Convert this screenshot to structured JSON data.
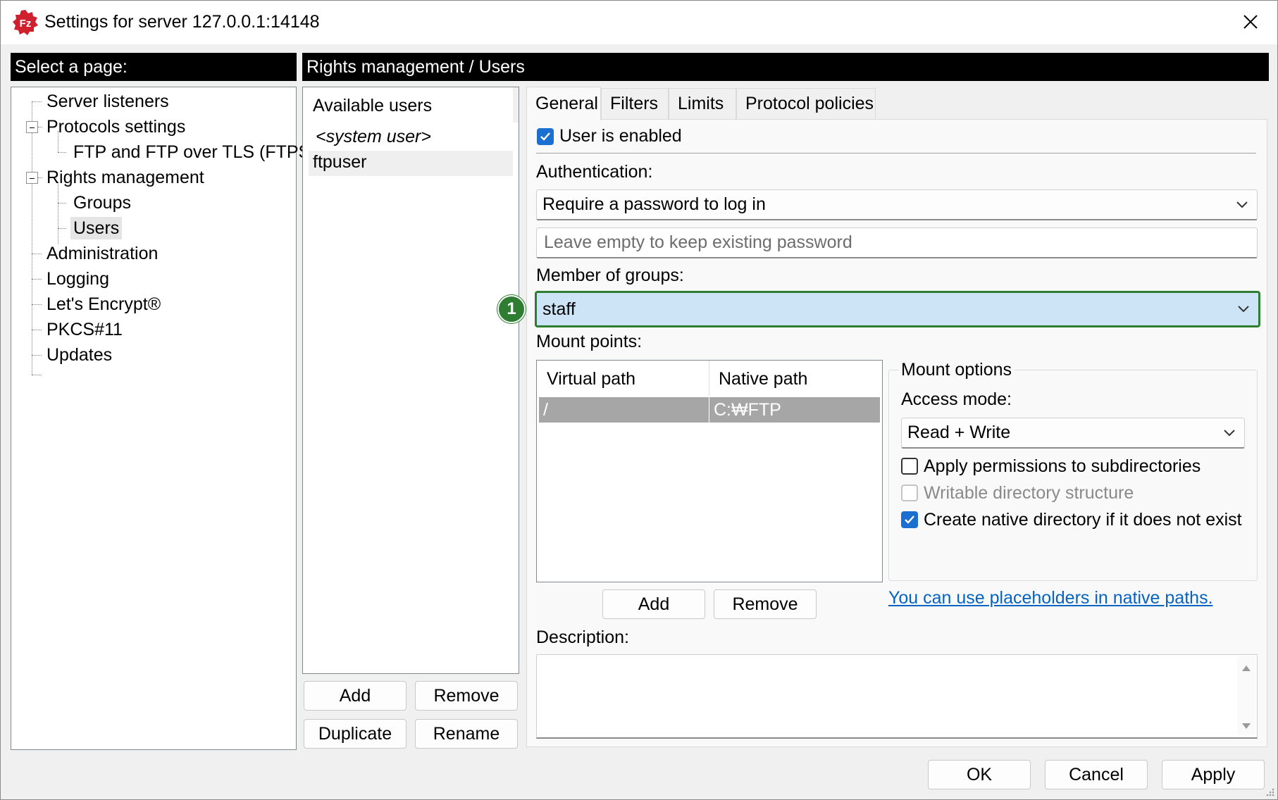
{
  "window": {
    "title": "Settings for server 127.0.0.1:14148"
  },
  "left_header": "Select a page:",
  "right_header": "Rights management / Users",
  "tree": {
    "server_listeners": "Server listeners",
    "protocols_settings": "Protocols settings",
    "ftp_ftps": "FTP and FTP over TLS (FTPS)",
    "rights_management": "Rights management",
    "groups": "Groups",
    "users": "Users",
    "administration": "Administration",
    "logging": "Logging",
    "lets_encrypt": "Let's Encrypt®",
    "pkcs11": "PKCS#11",
    "updates": "Updates"
  },
  "users_panel": {
    "header": "Available users",
    "items": [
      "<system user>",
      "ftpuser"
    ],
    "selected": "ftpuser",
    "add": "Add",
    "remove": "Remove",
    "duplicate": "Duplicate",
    "rename": "Rename"
  },
  "tabs": [
    "General",
    "Filters",
    "Limits",
    "Protocol policies"
  ],
  "active_tab": "General",
  "general": {
    "user_enabled_label": "User is enabled",
    "user_enabled": true,
    "authentication_label": "Authentication:",
    "authentication_value": "Require a password to log in",
    "password_placeholder": "Leave empty to keep existing password",
    "member_of_groups_label": "Member of groups:",
    "member_of_groups_value": "staff",
    "mount_points_label": "Mount points:",
    "mount_table": {
      "columns": [
        "Virtual path",
        "Native path"
      ],
      "rows": [
        [
          "/",
          "C:₩FTP"
        ]
      ]
    },
    "mount_add": "Add",
    "mount_remove": "Remove",
    "mount_options": {
      "title": "Mount options",
      "access_mode_label": "Access mode:",
      "access_mode_value": "Read + Write",
      "apply_permissions": "Apply permissions to subdirectories",
      "apply_permissions_checked": false,
      "writable_structure": "Writable directory structure",
      "writable_structure_checked": false,
      "create_native": "Create native directory if it does not exist",
      "create_native_checked": true
    },
    "placeholders_link": "You can use placeholders in native paths.",
    "description_label": "Description:",
    "description_value": ""
  },
  "annotation_badge": "1",
  "footer": {
    "ok": "OK",
    "cancel": "Cancel",
    "apply": "Apply"
  },
  "colors": {
    "accent": "#1a6fd1",
    "highlight_border": "#2e7d32",
    "highlight_fill": "#cde4f7",
    "brand": "#d0202e"
  }
}
